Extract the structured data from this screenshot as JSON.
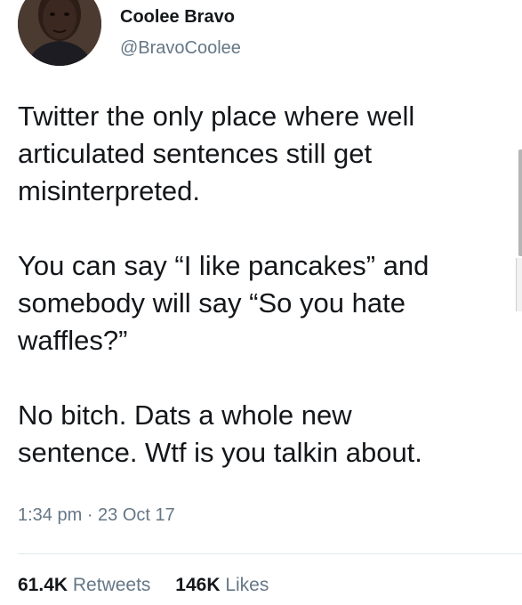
{
  "author": {
    "display_name": "Coolee Bravo",
    "handle": "@BravoCoolee",
    "avatar_icon": "profile-photo"
  },
  "tweet": {
    "paragraphs": [
      "Twitter the only place where well\narticulated sentences still get\nmisinterpreted.",
      "You can say “I like pancakes” and\nsomebody will say “So you hate\nwaffles?”",
      "No bitch. Dats a whole new\nsentence. Wtf is you talkin about."
    ],
    "timestamp": "1:34 pm · 23 Oct 17"
  },
  "stats": {
    "retweets_count": "61.4K",
    "retweets_label": "Retweets",
    "likes_count": "146K",
    "likes_label": "Likes"
  },
  "colors": {
    "text_primary": "#14171a",
    "text_secondary": "#657786",
    "divider": "#e1e8ed",
    "background": "#ffffff"
  }
}
